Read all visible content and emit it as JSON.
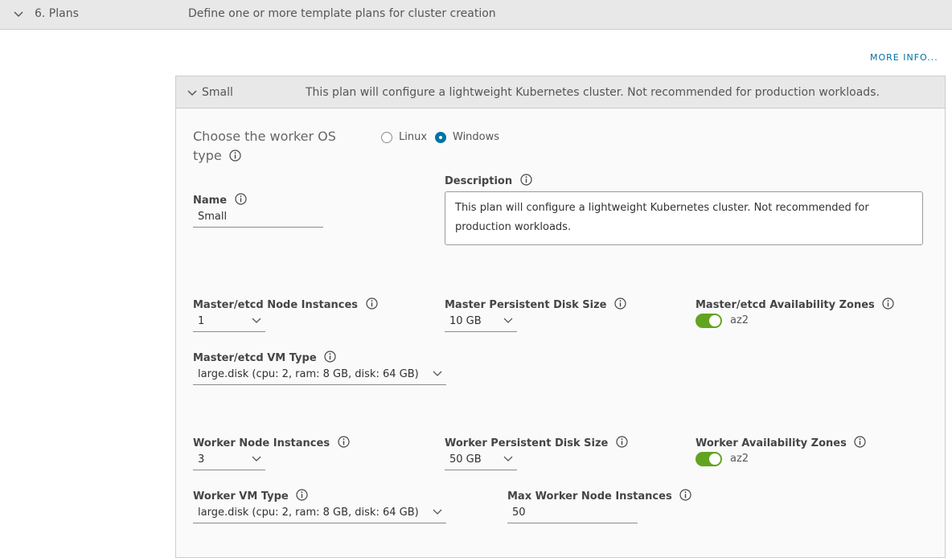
{
  "section": {
    "title": "6. Plans",
    "description": "Define one or more template plans for cluster creation",
    "more_info": "MORE INFO..."
  },
  "plan": {
    "name": "Small",
    "description": "This plan will configure a lightweight Kubernetes cluster. Not recommended for production workloads.",
    "os_type": {
      "label": "Choose the worker OS type",
      "options": [
        "Linux",
        "Windows"
      ],
      "selected": "Windows"
    },
    "fields": {
      "name": {
        "label": "Name",
        "value": "Small"
      },
      "description": {
        "label": "Description",
        "value": "This plan will configure a lightweight Kubernetes cluster. Not recommended for production workloads."
      },
      "master_instances": {
        "label": "Master/etcd Node Instances",
        "value": "1"
      },
      "master_disk": {
        "label": "Master Persistent Disk Size",
        "value": "10 GB"
      },
      "master_az": {
        "label": "Master/etcd Availability Zones",
        "zone": "az2",
        "enabled": true
      },
      "master_vm_type": {
        "label": "Master/etcd VM Type",
        "value": "large.disk (cpu: 2, ram: 8 GB, disk: 64 GB)"
      },
      "worker_instances": {
        "label": "Worker Node Instances",
        "value": "3"
      },
      "worker_disk": {
        "label": "Worker Persistent Disk Size",
        "value": "50 GB"
      },
      "worker_az": {
        "label": "Worker Availability Zones",
        "zone": "az2",
        "enabled": true
      },
      "worker_vm_type": {
        "label": "Worker VM Type",
        "value": "large.disk (cpu: 2, ram: 8 GB, disk: 64 GB)"
      },
      "max_worker": {
        "label": "Max Worker Node Instances",
        "value": "50"
      }
    }
  },
  "colors": {
    "accent": "#0072a3",
    "toggle_on": "#62a420",
    "header_bg": "#e8e8e8"
  }
}
